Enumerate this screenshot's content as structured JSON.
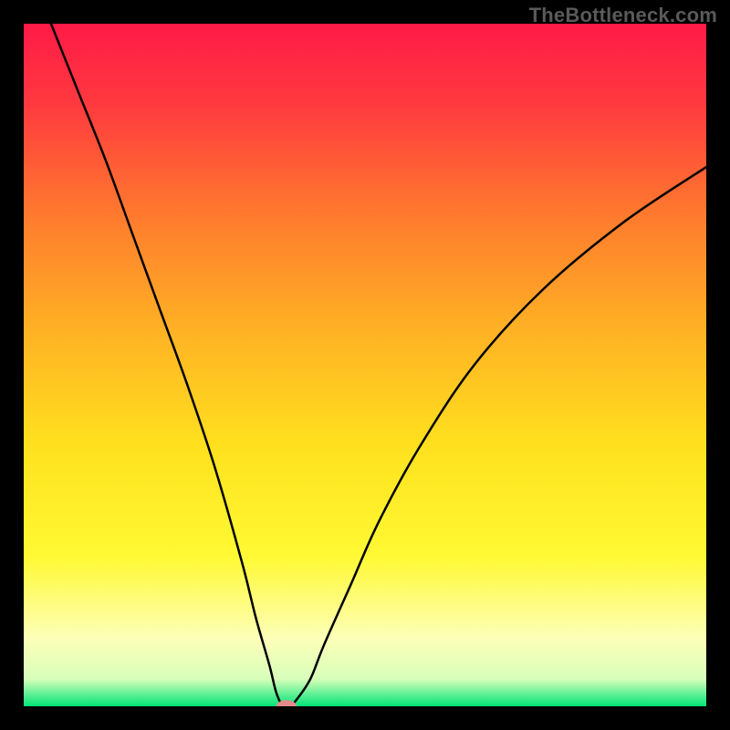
{
  "watermark": "TheBottleneck.com",
  "chart_data": {
    "type": "line",
    "title": "",
    "xlabel": "",
    "ylabel": "",
    "xlim": [
      0,
      100
    ],
    "ylim": [
      0,
      100
    ],
    "grid": false,
    "background": {
      "type": "vertical-gradient",
      "stops": [
        {
          "offset": 0.0,
          "color": "#ff1a47"
        },
        {
          "offset": 0.12,
          "color": "#ff3a3f"
        },
        {
          "offset": 0.28,
          "color": "#ff7a2e"
        },
        {
          "offset": 0.45,
          "color": "#ffb224"
        },
        {
          "offset": 0.62,
          "color": "#ffe11e"
        },
        {
          "offset": 0.78,
          "color": "#fff933"
        },
        {
          "offset": 0.9,
          "color": "#fdffb8"
        },
        {
          "offset": 0.96,
          "color": "#d8ffba"
        },
        {
          "offset": 1.0,
          "color": "#00e477"
        }
      ]
    },
    "curve_color": "#000000",
    "series": [
      {
        "name": "bottleneck-curve",
        "x": [
          4,
          8,
          12,
          16,
          20,
          24,
          28,
          32,
          34,
          36,
          37,
          38,
          39,
          40,
          42,
          44,
          48,
          52,
          58,
          66,
          76,
          88,
          100
        ],
        "y": [
          100,
          90,
          80,
          69,
          58,
          47,
          35,
          21,
          13,
          6,
          2,
          0,
          0,
          1,
          4,
          9,
          18,
          27,
          38,
          50,
          61,
          71,
          79
        ]
      }
    ],
    "marker": {
      "name": "min-marker",
      "x": 38.5,
      "y": 0,
      "rx": 1.5,
      "ry": 0.9,
      "color": "#e58a8a"
    },
    "note": "Values estimated from pixel positions relative to plot area; no numeric axis labels are rendered in the image."
  }
}
